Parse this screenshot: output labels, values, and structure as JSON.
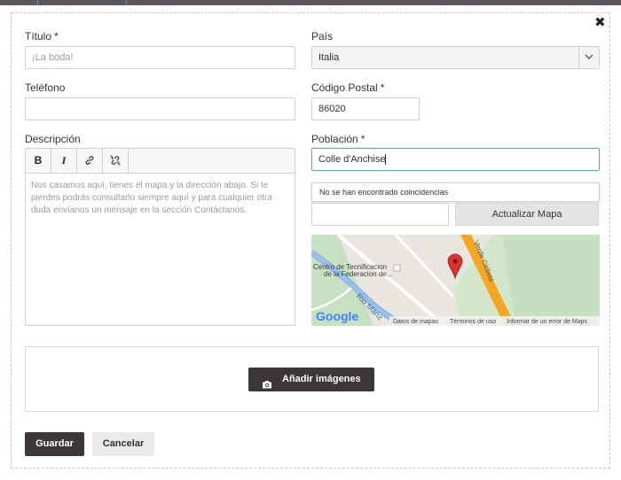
{
  "form": {
    "close_symbol": "✖",
    "title_label": "Título",
    "title_required": "*",
    "title_placeholder": "¡La boda!",
    "phone_label": "Teléfono",
    "description_label": "Descripción",
    "description_placeholder": "Nos casamos aquí, tienes el mapa y la dirección abajo. Si te pierdes podrás consultarlo siempre aquí y para cualquier otra duda envíanos un mensaje en la sección Contáctanos.",
    "country_label": "País",
    "country_value": "Italia",
    "postal_label": "Código Postal",
    "postal_required": "*",
    "postal_value": "86020",
    "town_label": "Población",
    "town_required": "*",
    "town_value": "Colle d'Anchise",
    "suggest_text": "No se han encontrado coincidencias",
    "update_map_label": "Actualizar Mapa",
    "add_images_label": "Añadir imágenes",
    "save_label": "Guardar",
    "cancel_label": "Cancelar"
  },
  "editor_toolbar": {
    "bold_label": "B",
    "italic_label": "I",
    "link_icon": "link-icon",
    "unlink_icon": "unlink-icon"
  },
  "map": {
    "place_label_line1": "Centro de Tecnificacion",
    "place_label_line2": "de la Federacion de...",
    "river_label": "Rio Manz",
    "road_label": "Verde Ciclista",
    "google_logo": "Google",
    "footer_data": "Datos de mapas",
    "footer_terms": "Términos de uso",
    "footer_report": "Informar de un error de Maps"
  },
  "colors": {
    "accent_dark": "#3b3737",
    "focus_border": "#5aa7c9",
    "map_road": "#f5a623",
    "map_pin": "#d9342b"
  }
}
